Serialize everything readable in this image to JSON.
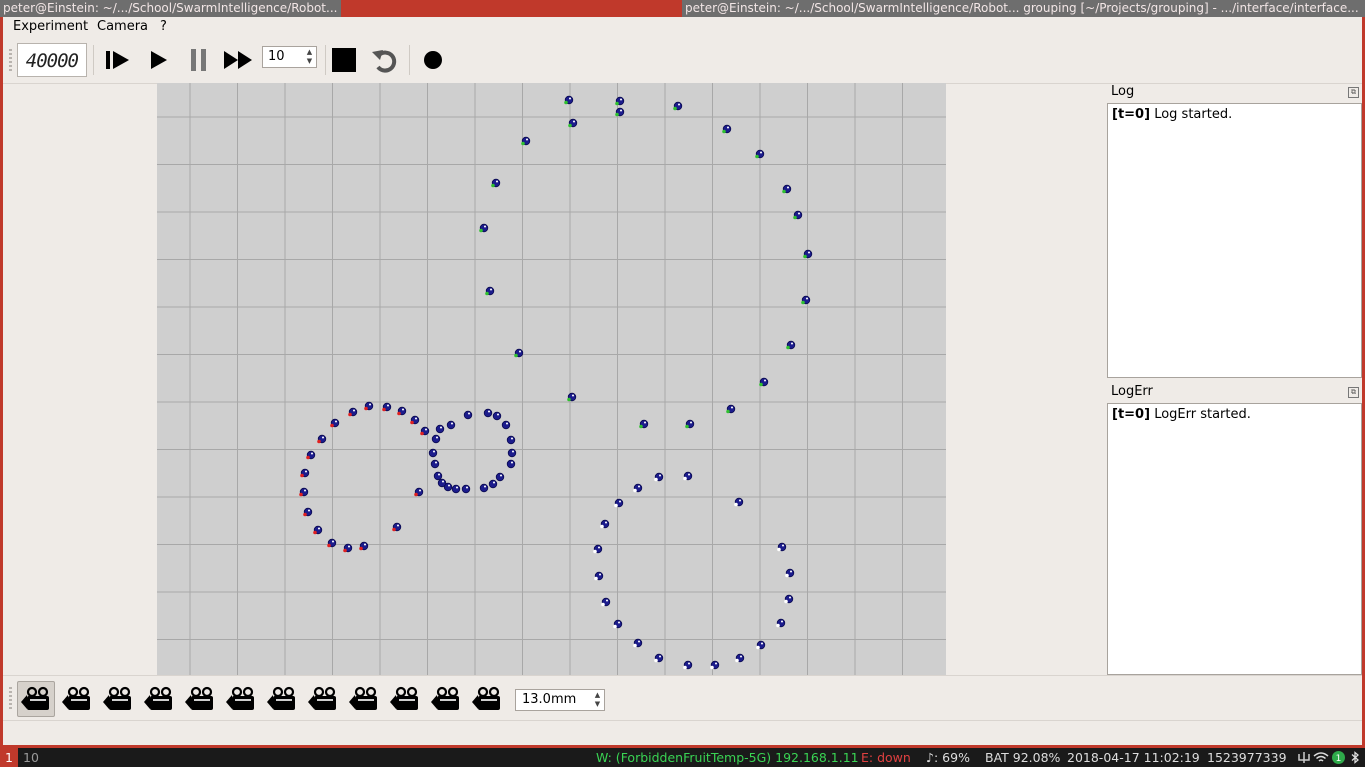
{
  "window": {
    "left_title": "peter@Einstein: ~/.../School/SwarmIntelligence/Robot...",
    "right_title": "peter@Einstein: ~/.../School/SwarmIntelligence/Robot... grouping [~/Projects/grouping] - .../interface/interface..."
  },
  "menu": {
    "experiment": "Experiment",
    "camera": "Camera",
    "help": "?"
  },
  "toolbar": {
    "step_counter": "40000",
    "speed": "10"
  },
  "docks": {
    "log": {
      "title": "Log",
      "tag": "[t=0]",
      "message": "Log started."
    },
    "logerr": {
      "title": "LogErr",
      "tag": "[t=0]",
      "message": "LogErr started."
    }
  },
  "camera_bar": {
    "camera_count": 12,
    "active_camera": 1,
    "focal_length": "13.0mm"
  },
  "sysbar": {
    "ws1": "1",
    "ws2": "10",
    "wifi": "W: (ForbiddenFruitTemp-5G) 192.168.1.11",
    "eth": "E: down",
    "volume": "♪: 69%",
    "battery": "BAT 92.08%",
    "datetime": "2018-04-17 11:02:19",
    "epoch": "1523977339",
    "tray_badge": "1"
  },
  "colors": {
    "accent_red": "#c0392b",
    "arena_floor": "#cfcfcf",
    "robot_body": "#1c1c8c",
    "led_red": "#e02020",
    "led_green": "#30c030",
    "wifi_text": "#39d353",
    "eth_text": "#e04040"
  }
}
